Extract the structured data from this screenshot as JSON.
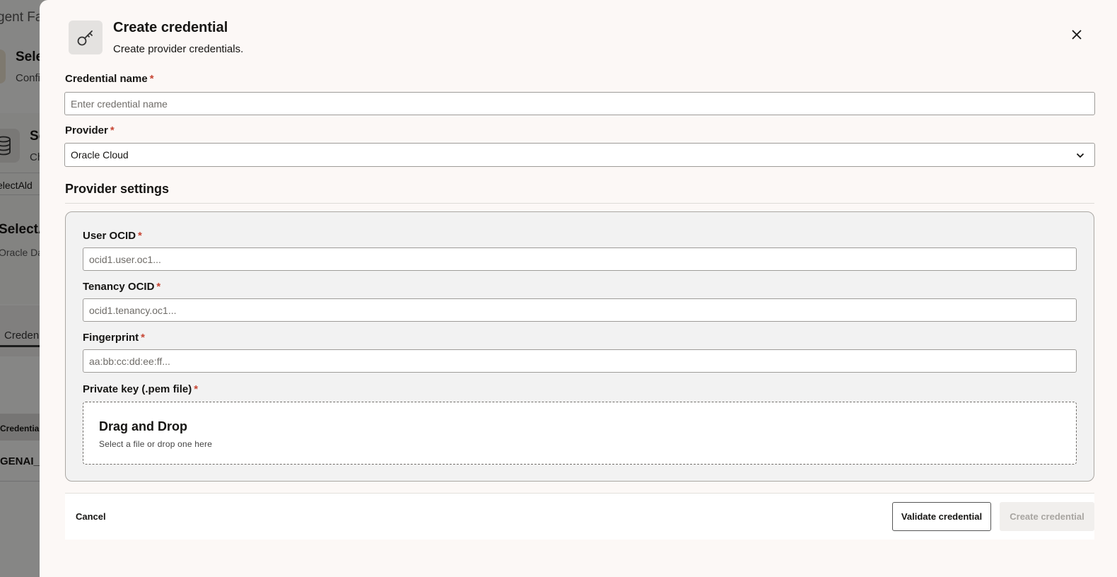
{
  "background": {
    "app_title": "gent Fa",
    "card1": {
      "title": "Sele",
      "subtitle": "Confi"
    },
    "card2": {
      "title": "Se",
      "subtitle": "Ch"
    },
    "select_value": "electAld",
    "section": {
      "title": "SelectA",
      "subtitle": "Oracle Da"
    },
    "tab_label": "Creden",
    "table_header": "Credential",
    "table_cell": "GENAI_"
  },
  "drawer": {
    "header": {
      "icon": "key-icon",
      "title": "Create credential",
      "subtitle": "Create provider credentials."
    },
    "close_icon": "close-icon",
    "required_marker": "*",
    "credential_name": {
      "label": "Credential name",
      "value": "",
      "placeholder": "Enter credential name"
    },
    "provider": {
      "label": "Provider",
      "selected": "Oracle Cloud"
    },
    "provider_settings": {
      "title": "Provider settings",
      "user_ocid": {
        "label": "User OCID",
        "value": "",
        "placeholder": "ocid1.user.oc1..."
      },
      "tenancy_ocid": {
        "label": "Tenancy OCID",
        "value": "",
        "placeholder": "ocid1.tenancy.oc1..."
      },
      "fingerprint": {
        "label": "Fingerprint",
        "value": "",
        "placeholder": "aa:bb:cc:dd:ee:ff..."
      },
      "private_key": {
        "label": "Private key (.pem file)",
        "dropzone_title": "Drag and Drop",
        "dropzone_subtitle": "Select a file or drop one here"
      }
    },
    "footer": {
      "cancel_label": "Cancel",
      "validate_label": "Validate credential",
      "create_label": "Create credential"
    }
  },
  "colors": {
    "required": "#c74634",
    "drawer_bg": "#fcf8f6",
    "panel_bg": "#f2f2f2",
    "disabled_text": "#a8a5a1"
  }
}
